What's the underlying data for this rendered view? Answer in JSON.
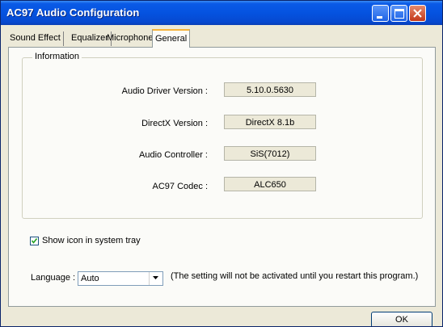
{
  "window": {
    "title": "AC97 Audio Configuration"
  },
  "tabs": [
    {
      "label": "Sound Effect"
    },
    {
      "label": "Equalizer"
    },
    {
      "label": "Microphone"
    },
    {
      "label": "General",
      "active": true
    }
  ],
  "info": {
    "group_label": "Information",
    "rows": [
      {
        "label": "Audio Driver Version :",
        "value": "5.10.0.5630"
      },
      {
        "label": "DirectX Version :",
        "value": "DirectX 8.1b"
      },
      {
        "label": "Audio Controller :",
        "value": "SiS(7012)"
      },
      {
        "label": "AC97 Codec :",
        "value": "ALC650"
      }
    ]
  },
  "tray": {
    "label": "Show icon in system tray",
    "checked": true
  },
  "language": {
    "label": "Language :",
    "selected": "Auto",
    "note": "(The setting will not be activated until you restart this program.)"
  },
  "buttons": {
    "ok": "OK"
  },
  "colors": {
    "titlebar": "#0553e0",
    "dialog_bg": "#ece9d8",
    "active_tab_accent": "#f6b33a"
  }
}
